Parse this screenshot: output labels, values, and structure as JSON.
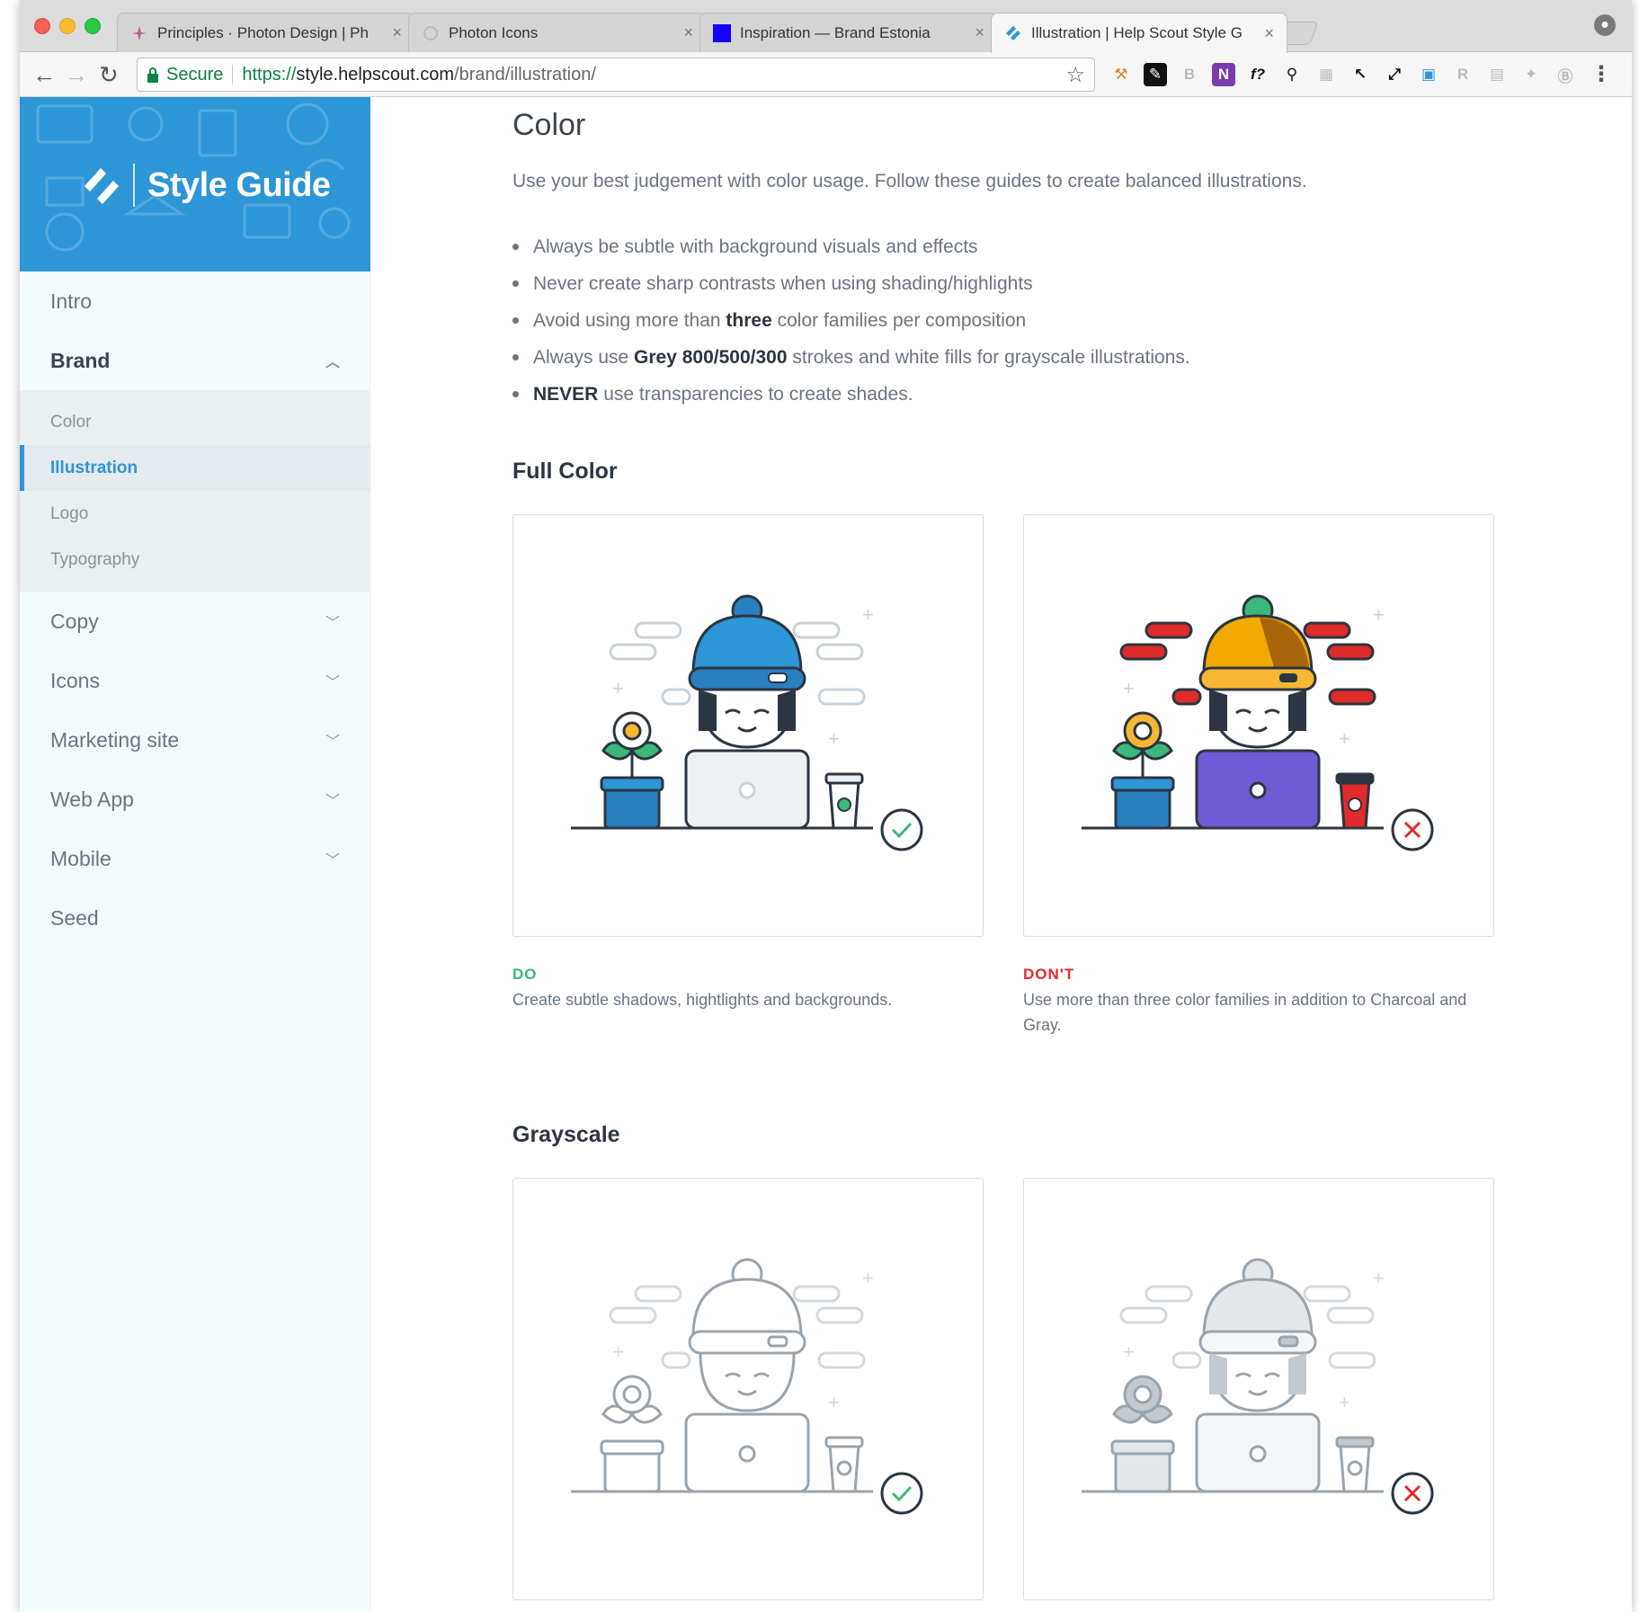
{
  "browser": {
    "tabs": [
      {
        "title": "Principles · Photon Design | Ph",
        "close": "×"
      },
      {
        "title": "Photon Icons",
        "close": "×"
      },
      {
        "title": "Inspiration — Brand Estonia",
        "close": "×"
      },
      {
        "title": "Illustration | Help Scout Style G",
        "close": "×"
      }
    ],
    "secure_label": "Secure",
    "url_scheme": "https://",
    "url_host": "style.helpscout.com",
    "url_path": "/brand/illustration/"
  },
  "sidebar": {
    "logo_label": "Style Guide",
    "items": [
      {
        "label": "Intro"
      },
      {
        "label": "Brand"
      },
      {
        "label": "Copy"
      },
      {
        "label": "Icons"
      },
      {
        "label": "Marketing site"
      },
      {
        "label": "Web App"
      },
      {
        "label": "Mobile"
      },
      {
        "label": "Seed"
      }
    ],
    "brand_sub": [
      {
        "label": "Color"
      },
      {
        "label": "Illustration"
      },
      {
        "label": "Logo"
      },
      {
        "label": "Typography"
      }
    ]
  },
  "content": {
    "title": "Color",
    "intro": "Use your best judgement with color usage. Follow these guides to create balanced illustrations.",
    "bullets": [
      {
        "pre": "Always be subtle with background visuals and effects",
        "bold": "",
        "post": ""
      },
      {
        "pre": "Never create sharp contrasts when using shading/highlights",
        "bold": "",
        "post": ""
      },
      {
        "pre": "Avoid using more than ",
        "bold": "three",
        "post": " color families per composition"
      },
      {
        "pre": "Always use ",
        "bold": "Grey 800/500/300",
        "post": " strokes and white fills for grayscale illustrations."
      },
      {
        "pre": "",
        "bold": "NEVER",
        "post": " use transparencies to create shades."
      }
    ],
    "full_color": {
      "heading": "Full Color",
      "do_label": "DO",
      "do_text": "Create subtle shadows, hightlights and backgrounds.",
      "dont_label": "DON'T",
      "dont_text": "Use more than three color families in addition to Charcoal and Gray."
    },
    "grayscale": {
      "heading": "Grayscale"
    }
  },
  "colors": {
    "brand_blue": "#2d96d6",
    "do_green": "#3cb878",
    "dont_red": "#e02b2b",
    "text_dark": "#2c3642",
    "text_muted": "#6b7480"
  }
}
